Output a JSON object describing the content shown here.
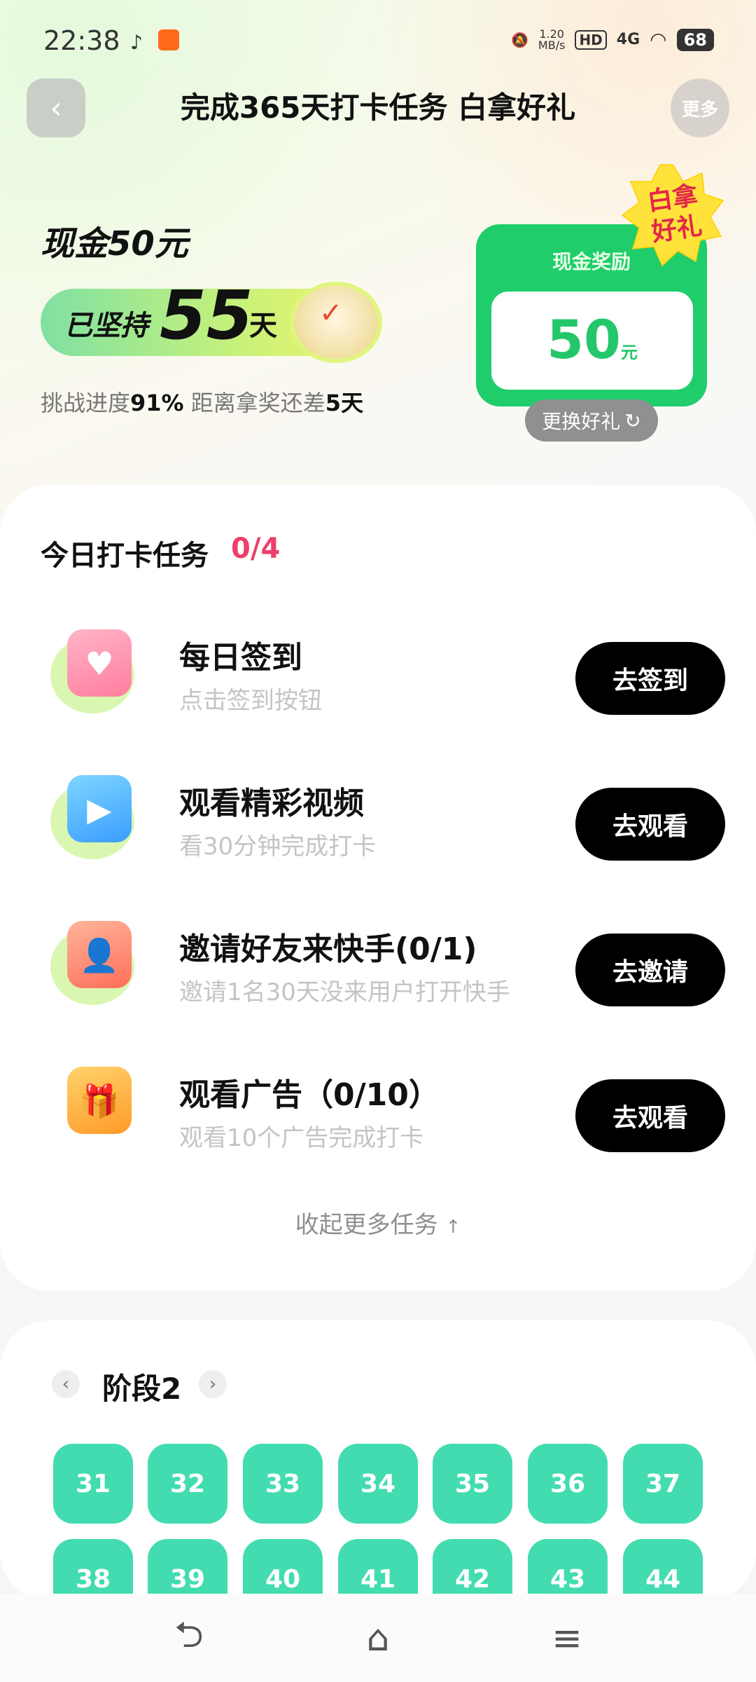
{
  "status_bar": {
    "time": "22:38",
    "net_speed_value": "1.20",
    "net_speed_unit": "MB/s",
    "hd": "HD",
    "network": "4G",
    "battery": "68"
  },
  "header": {
    "title": "完成365天打卡任务 白拿好礼",
    "more_label": "更多",
    "back_icon": "chevron-left-icon"
  },
  "hero": {
    "cash_title": "现金50元",
    "streak_prefix": "已坚持",
    "streak_days": "55",
    "streak_suffix": "天",
    "progress_prefix": "挑战进度",
    "progress_percent": "91%",
    "progress_mid": " 距离拿奖还差",
    "days_left": "5天"
  },
  "reward_card": {
    "heading": "现金奖励",
    "value": "50",
    "unit": "元",
    "badge_line1": "白拿",
    "badge_line2": "好礼",
    "swap_label": "更换好礼",
    "accent": "#1fce6b"
  },
  "tasks": {
    "title": "今日打卡任务",
    "count": "0/4",
    "items": [
      {
        "name": "每日签到",
        "desc": "点击签到按钮",
        "button": "去签到",
        "icon": "calendar-heart-icon"
      },
      {
        "name": "观看精彩视频",
        "desc": "看30分钟完成打卡",
        "button": "去观看",
        "icon": "video-play-icon"
      },
      {
        "name": "邀请好友来快手(0/1)",
        "desc": "邀请1名30天没来用户打开快手",
        "button": "去邀请",
        "icon": "invite-user-icon"
      },
      {
        "name": "观看广告（0/10）",
        "desc": "观看10个广告完成打卡",
        "button": "去观看",
        "icon": "gift-box-icon"
      }
    ],
    "collapse_label": "收起更多任务"
  },
  "stage": {
    "title": "阶段2",
    "days": [
      "31",
      "32",
      "33",
      "34",
      "35",
      "36",
      "37",
      "38",
      "39",
      "40",
      "41",
      "42",
      "43",
      "44"
    ],
    "day_color": "#42dcb0"
  },
  "nav": {
    "back": "back-icon",
    "home": "home-icon",
    "menu": "menu-icon"
  }
}
